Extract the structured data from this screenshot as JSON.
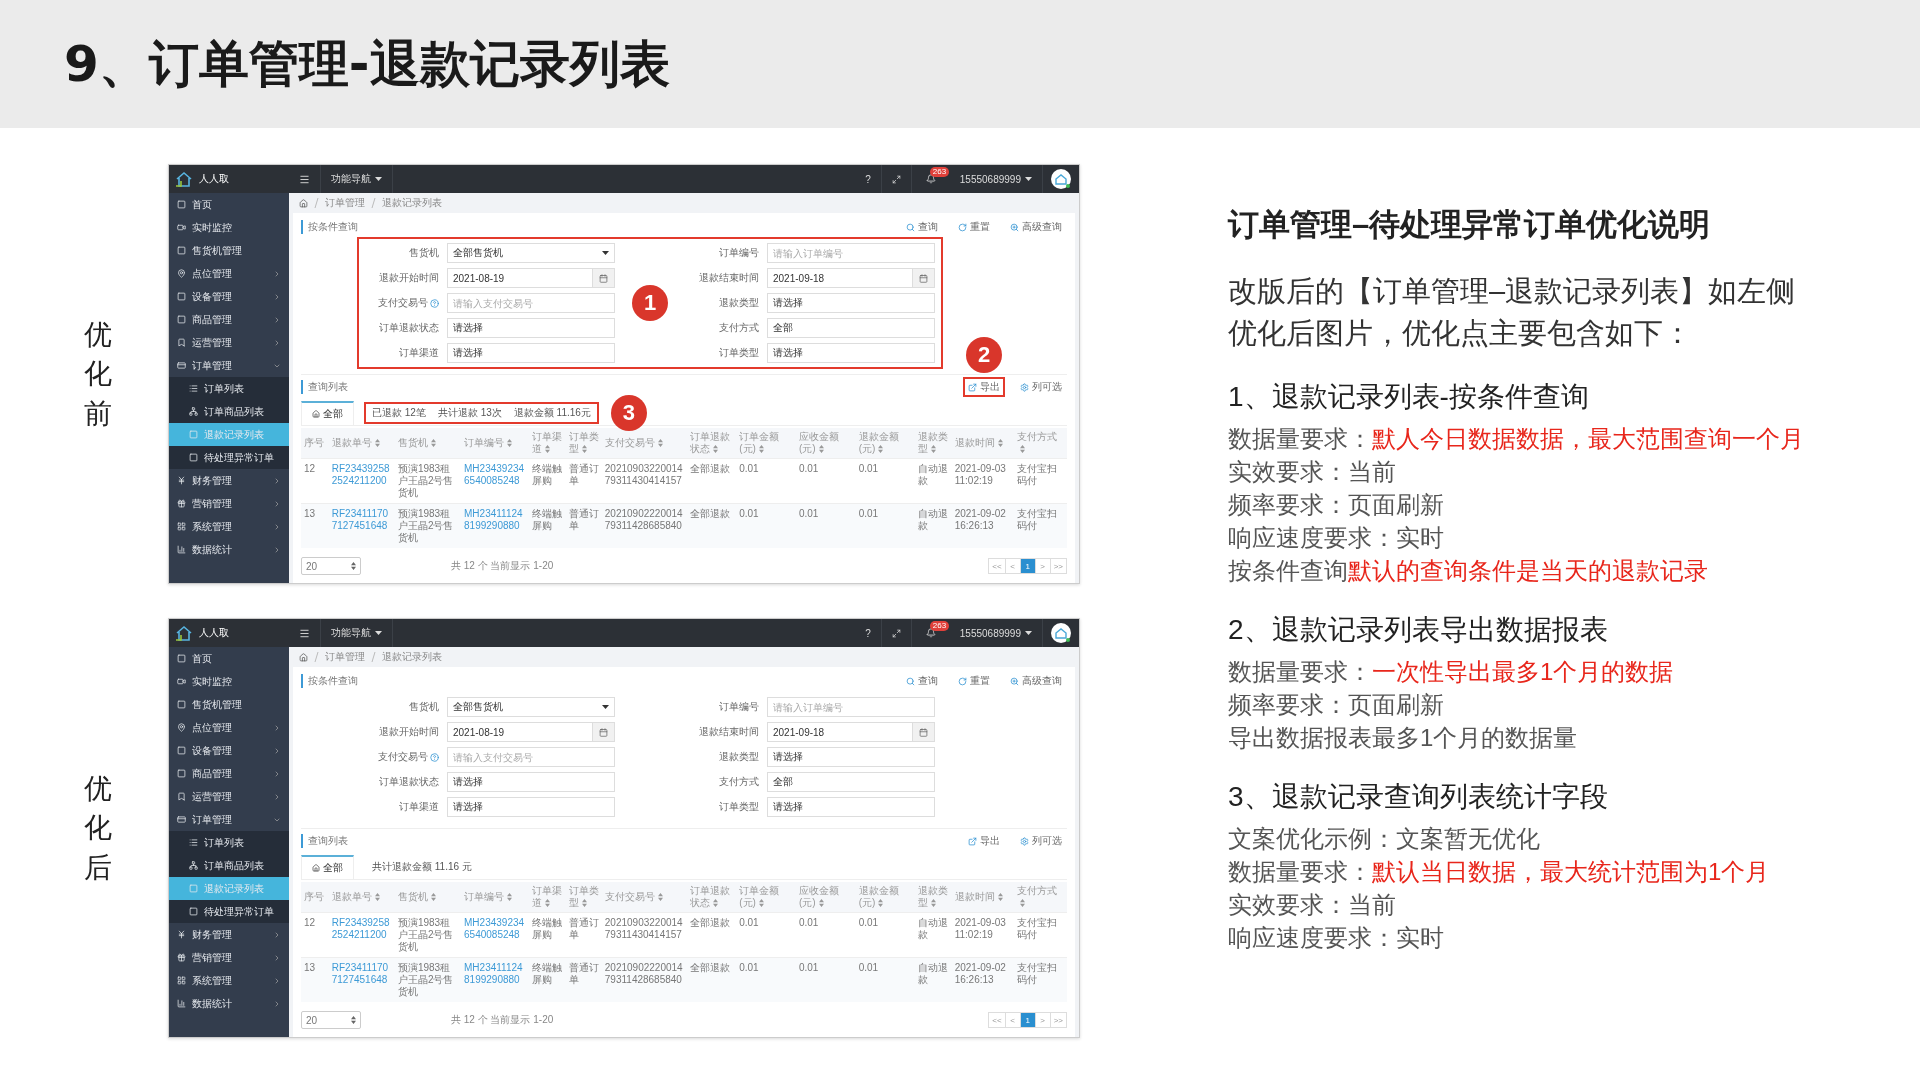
{
  "slide_title": "9、订单管理-退款记录列表",
  "versions": [
    {
      "label": "优化前",
      "screen": {
        "topbar": {
          "brand": "人人取",
          "nav": "功能导航",
          "help": "?",
          "notifications": "263",
          "user": "15550689999"
        },
        "sidebar": [
          {
            "kind": "link",
            "label": "首页",
            "selected": false
          },
          {
            "kind": "link",
            "label": "实时监控",
            "selected": false
          },
          {
            "kind": "link",
            "label": "售货机管理",
            "selected": false
          },
          {
            "kind": "group",
            "label": "点位管理",
            "expanded": false
          },
          {
            "kind": "group",
            "label": "设备管理",
            "expanded": false
          },
          {
            "kind": "group",
            "label": "商品管理",
            "expanded": false
          },
          {
            "kind": "group",
            "label": "运营管理",
            "expanded": false
          },
          {
            "kind": "group",
            "label": "订单管理",
            "expanded": true,
            "children": [
              {
                "label": "订单列表",
                "selected": false
              },
              {
                "label": "订单商品列表",
                "selected": false
              },
              {
                "label": "退款记录列表",
                "selected": true
              },
              {
                "label": "待处理异常订单",
                "selected": false
              }
            ]
          },
          {
            "kind": "group",
            "label": "财务管理",
            "expanded": false
          },
          {
            "kind": "group",
            "label": "营销管理",
            "expanded": false
          },
          {
            "kind": "group",
            "label": "系统管理",
            "expanded": false
          },
          {
            "kind": "group",
            "label": "数据统计",
            "expanded": false
          }
        ],
        "breadcrumb": [
          "订单管理",
          "退款记录列表"
        ],
        "search": {
          "title": "按条件查询",
          "actions": [
            "查询",
            "重置",
            "高级查询"
          ],
          "callout": "1",
          "fields": [
            {
              "label": "售货机",
              "kind": "select",
              "value": "全部售货机"
            },
            {
              "label": "订单编号",
              "kind": "text",
              "placeholder": "请输入订单编号"
            },
            {
              "label": "退款开始时间",
              "kind": "date",
              "value": "2021-08-19"
            },
            {
              "label": "退款结束时间",
              "kind": "date",
              "value": "2021-09-18"
            },
            {
              "label": "支付交易号",
              "kind": "text",
              "info": true,
              "placeholder": "请输入支付交易号"
            },
            {
              "label": "退款类型",
              "kind": "text",
              "value": "请选择"
            },
            {
              "label": "订单退款状态",
              "kind": "text",
              "value": "请选择"
            },
            {
              "label": "支付方式",
              "kind": "text",
              "value": "全部"
            },
            {
              "label": "订单渠道",
              "kind": "text",
              "value": "请选择"
            },
            {
              "label": "订单类型",
              "kind": "text",
              "value": "请选择"
            }
          ]
        },
        "list": {
          "title": "查询列表",
          "actions": [
            {
              "label": "导出",
              "callout": "2"
            },
            {
              "label": "列可选"
            }
          ],
          "tabs": [
            {
              "label": "全部",
              "selected": true
            }
          ],
          "stats": {
            "items": [
              "已退款 12笔",
              "共计退款 13次",
              "退款金额 11.16元"
            ],
            "callout": "3"
          },
          "table": {
            "columns": [
              {
                "label": "序号",
                "sortable": false
              },
              {
                "label": "退款单号",
                "sortable": true,
                "link": true
              },
              {
                "label": "售货机",
                "sortable": true
              },
              {
                "label": "订单编号",
                "sortable": true,
                "link": true
              },
              {
                "label": "订单渠道",
                "sortable": true
              },
              {
                "label": "订单类型",
                "sortable": true
              },
              {
                "label": "支付交易号",
                "sortable": true
              },
              {
                "label": "订单退款状态",
                "sortable": true
              },
              {
                "label": "订单金额(元)",
                "sortable": true
              },
              {
                "label": "应收金额(元)",
                "sortable": true
              },
              {
                "label": "退款金额(元)",
                "sortable": true
              },
              {
                "label": "退款类型",
                "sortable": true
              },
              {
                "label": "退款时间",
                "sortable": true
              },
              {
                "label": "支付方式",
                "sortable": true
              }
            ],
            "rows": [
              [
                "12",
                "RF234392582524211200",
                "预演1983租户王晶2号售货机",
                "MH234392346540085248",
                "终端触屏购",
                "普通订单",
                "2021090322001479311430414157",
                "全部退款",
                "0.01",
                "0.01",
                "0.01",
                "自动退款",
                "2021-09-03 11:02:19",
                "支付宝扫码付"
              ],
              [
                "13",
                "RF234111707127451648",
                "预演1983租户王晶2号售货机",
                "MH234111248199290880",
                "终端触屏购",
                "普通订单",
                "2021090222001479311428685840",
                "全部退款",
                "0.01",
                "0.01",
                "0.01",
                "自动退款",
                "2021-09-02 16:26:13",
                "支付宝扫码付"
              ]
            ]
          },
          "footer": {
            "page_size": "20",
            "summary": "共 12 个 当前显示 1-20",
            "pages": [
              {
                "label": "<<",
                "selected": false
              },
              {
                "label": "<",
                "selected": false
              },
              {
                "label": "1",
                "selected": true
              },
              {
                "label": ">",
                "selected": false
              },
              {
                "label": ">>",
                "selected": false
              }
            ]
          }
        }
      }
    },
    {
      "label": "优化后",
      "screen": {
        "topbar": {
          "brand": "人人取",
          "nav": "功能导航",
          "help": "?",
          "notifications": "263",
          "user": "15550689999"
        },
        "sidebar": [
          {
            "kind": "link",
            "label": "首页",
            "selected": false
          },
          {
            "kind": "link",
            "label": "实时监控",
            "selected": false
          },
          {
            "kind": "link",
            "label": "售货机管理",
            "selected": false
          },
          {
            "kind": "group",
            "label": "点位管理",
            "expanded": false
          },
          {
            "kind": "group",
            "label": "设备管理",
            "expanded": false
          },
          {
            "kind": "group",
            "label": "商品管理",
            "expanded": false
          },
          {
            "kind": "group",
            "label": "运营管理",
            "expanded": false
          },
          {
            "kind": "group",
            "label": "订单管理",
            "expanded": true,
            "children": [
              {
                "label": "订单列表",
                "selected": false
              },
              {
                "label": "订单商品列表",
                "selected": false
              },
              {
                "label": "退款记录列表",
                "selected": true
              },
              {
                "label": "待处理异常订单",
                "selected": false
              }
            ]
          },
          {
            "kind": "group",
            "label": "财务管理",
            "expanded": false
          },
          {
            "kind": "group",
            "label": "营销管理",
            "expanded": false
          },
          {
            "kind": "group",
            "label": "系统管理",
            "expanded": false
          },
          {
            "kind": "group",
            "label": "数据统计",
            "expanded": false
          }
        ],
        "breadcrumb": [
          "订单管理",
          "退款记录列表"
        ],
        "search": {
          "title": "按条件查询",
          "actions": [
            "查询",
            "重置",
            "高级查询"
          ],
          "fields": [
            {
              "label": "售货机",
              "kind": "select",
              "value": "全部售货机"
            },
            {
              "label": "订单编号",
              "kind": "text",
              "placeholder": "请输入订单编号"
            },
            {
              "label": "退款开始时间",
              "kind": "date",
              "value": "2021-08-19"
            },
            {
              "label": "退款结束时间",
              "kind": "date",
              "value": "2021-09-18"
            },
            {
              "label": "支付交易号",
              "kind": "text",
              "info": true,
              "placeholder": "请输入支付交易号"
            },
            {
              "label": "退款类型",
              "kind": "text",
              "value": "请选择"
            },
            {
              "label": "订单退款状态",
              "kind": "text",
              "value": "请选择"
            },
            {
              "label": "支付方式",
              "kind": "text",
              "value": "全部"
            },
            {
              "label": "订单渠道",
              "kind": "text",
              "value": "请选择"
            },
            {
              "label": "订单类型",
              "kind": "text",
              "value": "请选择"
            }
          ]
        },
        "list": {
          "title": "查询列表",
          "actions": [
            {
              "label": "导出"
            },
            {
              "label": "列可选"
            }
          ],
          "tabs": [
            {
              "label": "全部",
              "selected": true
            }
          ],
          "stats": {
            "items": [
              "共计退款金额 11.16 元"
            ]
          },
          "table": {
            "columns": [
              {
                "label": "序号",
                "sortable": false
              },
              {
                "label": "退款单号",
                "sortable": true,
                "link": true
              },
              {
                "label": "售货机",
                "sortable": true
              },
              {
                "label": "订单编号",
                "sortable": true,
                "link": true
              },
              {
                "label": "订单渠道",
                "sortable": true
              },
              {
                "label": "订单类型",
                "sortable": true
              },
              {
                "label": "支付交易号",
                "sortable": true
              },
              {
                "label": "订单退款状态",
                "sortable": true
              },
              {
                "label": "订单金额(元)",
                "sortable": true
              },
              {
                "label": "应收金额(元)",
                "sortable": true
              },
              {
                "label": "退款金额(元)",
                "sortable": true
              },
              {
                "label": "退款类型",
                "sortable": true
              },
              {
                "label": "退款时间",
                "sortable": true
              },
              {
                "label": "支付方式",
                "sortable": true
              }
            ],
            "rows": [
              [
                "12",
                "RF234392582524211200",
                "预演1983租户王晶2号售货机",
                "MH234392346540085248",
                "终端触屏购",
                "普通订单",
                "2021090322001479311430414157",
                "全部退款",
                "0.01",
                "0.01",
                "0.01",
                "自动退款",
                "2021-09-03 11:02:19",
                "支付宝扫码付"
              ],
              [
                "13",
                "RF234111707127451648",
                "预演1983租户王晶2号售货机",
                "MH234111248199290880",
                "终端触屏购",
                "普通订单",
                "2021090222001479311428685840",
                "全部退款",
                "0.01",
                "0.01",
                "0.01",
                "自动退款",
                "2021-09-02 16:26:13",
                "支付宝扫码付"
              ]
            ]
          },
          "footer": {
            "page_size": "20",
            "summary": "共 12 个 当前显示 1-20",
            "pages": [
              {
                "label": "<<",
                "selected": false
              },
              {
                "label": "<",
                "selected": false
              },
              {
                "label": "1",
                "selected": true
              },
              {
                "label": ">",
                "selected": false
              },
              {
                "label": ">>",
                "selected": false
              }
            ]
          }
        }
      }
    }
  ],
  "notes": {
    "title": "订单管理–待处理异常订单优化说明",
    "intro": "改版后的【订单管理–退款记录列表】如左侧优化后图片，优化点主要包含如下：",
    "sections": [
      {
        "heading": "1、退款记录列表-按条件查询",
        "lines": [
          {
            "text": "数据量要求：",
            "highlight": "默人今日数据数据，最大范围查询一个月"
          },
          {
            "text": "实效要求：当前"
          },
          {
            "text": "频率要求：页面刷新"
          },
          {
            "text": "响应速度要求：实时"
          },
          {
            "text": "按条件查询",
            "highlight": "默认的查询条件是当天的退款记录"
          }
        ]
      },
      {
        "heading": "2、退款记录列表导出数据报表",
        "lines": [
          {
            "text": "数据量要求：",
            "highlight": "一次性导出最多1个月的数据"
          },
          {
            "text": "频率要求：页面刷新"
          },
          {
            "text": "导出数据报表最多1个月的数据量"
          }
        ]
      },
      {
        "heading": "3、退款记录查询列表统计字段",
        "lines": [
          {
            "text": "文案优化示例：文案暂无优化"
          },
          {
            "text": "数据量要求：",
            "highlight": "默认当日数据，最大统计范围为1个月"
          },
          {
            "text": "实效要求：当前"
          },
          {
            "text": "响应速度要求：实时"
          }
        ]
      }
    ]
  }
}
